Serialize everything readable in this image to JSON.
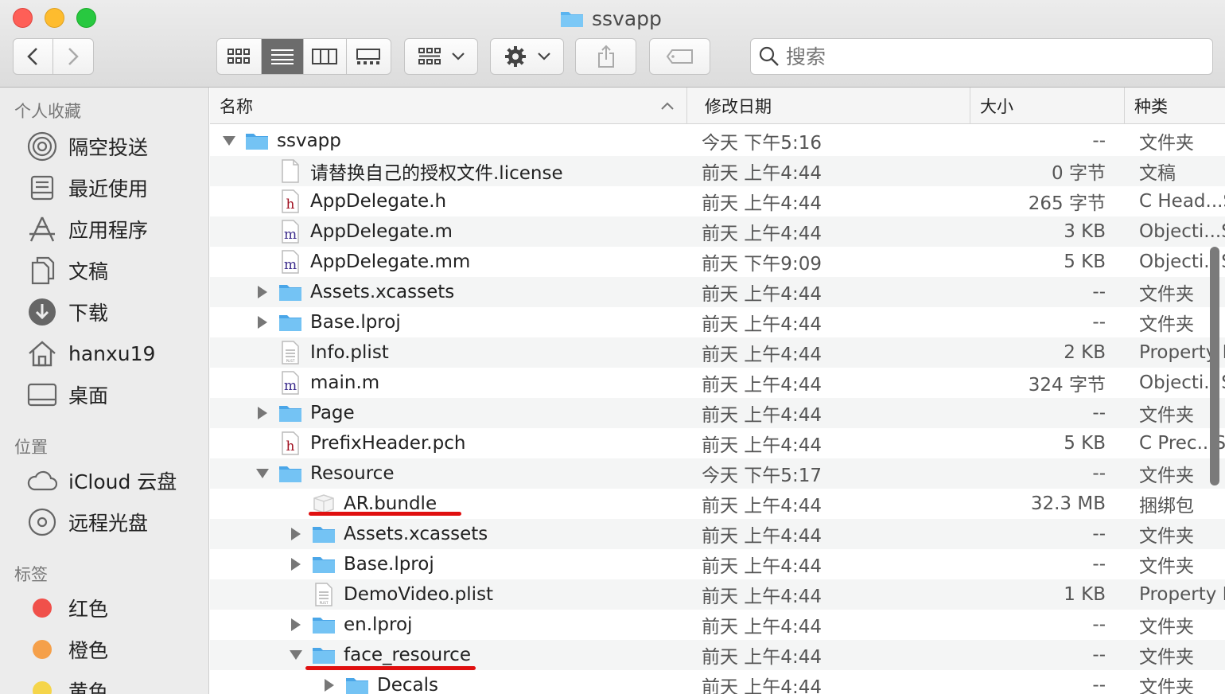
{
  "window": {
    "title": "ssvapp"
  },
  "toolbar": {
    "view_icons": [
      "icon-view-icon",
      "list-view-icon",
      "column-view-icon",
      "gallery-view-icon"
    ],
    "group_icon": "group-icon",
    "action_icon": "gear-icon",
    "share_icon": "share-icon",
    "tag_icon": "tag-icon"
  },
  "search": {
    "placeholder": "搜索"
  },
  "sidebar": {
    "favorites_label": "个人收藏",
    "favorites": [
      {
        "label": "隔空投送",
        "icon": "airdrop-icon"
      },
      {
        "label": "最近使用",
        "icon": "recents-icon"
      },
      {
        "label": "应用程序",
        "icon": "applications-icon"
      },
      {
        "label": "文稿",
        "icon": "documents-icon"
      },
      {
        "label": "下载",
        "icon": "downloads-icon"
      },
      {
        "label": "hanxu19",
        "icon": "home-icon"
      },
      {
        "label": "桌面",
        "icon": "desktop-icon"
      }
    ],
    "locations_label": "位置",
    "locations": [
      {
        "label": "iCloud 云盘",
        "icon": "cloud-icon"
      },
      {
        "label": "远程光盘",
        "icon": "disc-icon"
      }
    ],
    "tags_label": "标签",
    "tags": [
      {
        "label": "红色",
        "color": "#f0504a"
      },
      {
        "label": "橙色",
        "color": "#f5a04a"
      },
      {
        "label": "黄色",
        "color": "#f5d54a"
      }
    ]
  },
  "columns": {
    "name": "名称",
    "date": "修改日期",
    "size": "大小",
    "kind": "种类"
  },
  "files": [
    {
      "name": "ssvapp",
      "date": "今天 下午5:16",
      "size": "--",
      "kind": "文件夹",
      "indent": 0,
      "disclosure": "open",
      "icon": "folder-icon"
    },
    {
      "name": "请替换自己的授权文件.license",
      "date": "前天 上午4:44",
      "size": "0 字节",
      "kind": "文稿",
      "indent": 1,
      "disclosure": "none",
      "icon": "document-icon"
    },
    {
      "name": "AppDelegate.h",
      "date": "前天 上午4:44",
      "size": "265 字节",
      "kind": "C Head...S",
      "indent": 1,
      "disclosure": "none",
      "icon": "h-file-icon",
      "letter": "h"
    },
    {
      "name": "AppDelegate.m",
      "date": "前天 上午4:44",
      "size": "3 KB",
      "kind": "Objecti...S",
      "indent": 1,
      "disclosure": "none",
      "icon": "m-file-icon",
      "letter": "m"
    },
    {
      "name": "AppDelegate.mm",
      "date": "前天 下午9:09",
      "size": "5 KB",
      "kind": "Objecti...S",
      "indent": 1,
      "disclosure": "none",
      "icon": "m-file-icon",
      "letter": "m"
    },
    {
      "name": "Assets.xcassets",
      "date": "前天 上午4:44",
      "size": "--",
      "kind": "文件夹",
      "indent": 1,
      "disclosure": "closed",
      "icon": "folder-icon"
    },
    {
      "name": "Base.lproj",
      "date": "前天 上午4:44",
      "size": "--",
      "kind": "文件夹",
      "indent": 1,
      "disclosure": "closed",
      "icon": "folder-icon"
    },
    {
      "name": "Info.plist",
      "date": "前天 上午4:44",
      "size": "2 KB",
      "kind": "Property L",
      "indent": 1,
      "disclosure": "none",
      "icon": "plist-icon"
    },
    {
      "name": "main.m",
      "date": "前天 上午4:44",
      "size": "324 字节",
      "kind": "Objecti...S",
      "indent": 1,
      "disclosure": "none",
      "icon": "m-file-icon",
      "letter": "m"
    },
    {
      "name": "Page",
      "date": "前天 上午4:44",
      "size": "--",
      "kind": "文件夹",
      "indent": 1,
      "disclosure": "closed",
      "icon": "folder-icon"
    },
    {
      "name": "PrefixHeader.pch",
      "date": "前天 上午4:44",
      "size": "5 KB",
      "kind": "C Prec...S",
      "indent": 1,
      "disclosure": "none",
      "icon": "h-file-icon",
      "letter": "h"
    },
    {
      "name": "Resource",
      "date": "今天 下午5:17",
      "size": "--",
      "kind": "文件夹",
      "indent": 1,
      "disclosure": "open",
      "icon": "folder-icon"
    },
    {
      "name": "AR.bundle",
      "date": "前天 上午4:44",
      "size": "32.3 MB",
      "kind": "捆绑包",
      "indent": 2,
      "disclosure": "none",
      "icon": "bundle-icon"
    },
    {
      "name": "Assets.xcassets",
      "date": "前天 上午4:44",
      "size": "--",
      "kind": "文件夹",
      "indent": 2,
      "disclosure": "closed",
      "icon": "folder-icon"
    },
    {
      "name": "Base.lproj",
      "date": "前天 上午4:44",
      "size": "--",
      "kind": "文件夹",
      "indent": 2,
      "disclosure": "closed",
      "icon": "folder-icon"
    },
    {
      "name": "DemoVideo.plist",
      "date": "前天 上午4:44",
      "size": "1 KB",
      "kind": "Property L",
      "indent": 2,
      "disclosure": "none",
      "icon": "plist-icon"
    },
    {
      "name": "en.lproj",
      "date": "前天 上午4:44",
      "size": "--",
      "kind": "文件夹",
      "indent": 2,
      "disclosure": "closed",
      "icon": "folder-icon"
    },
    {
      "name": "face_resource",
      "date": "前天 上午4:44",
      "size": "--",
      "kind": "文件夹",
      "indent": 2,
      "disclosure": "open",
      "icon": "folder-icon"
    },
    {
      "name": "Decals",
      "date": "前天 上午4:44",
      "size": "--",
      "kind": "文件夹",
      "indent": 3,
      "disclosure": "closed",
      "icon": "folder-icon"
    }
  ],
  "colors": {
    "folder": "#5ab4f0",
    "annotation": "#e01010",
    "selected_view": "#6c6c6c"
  }
}
